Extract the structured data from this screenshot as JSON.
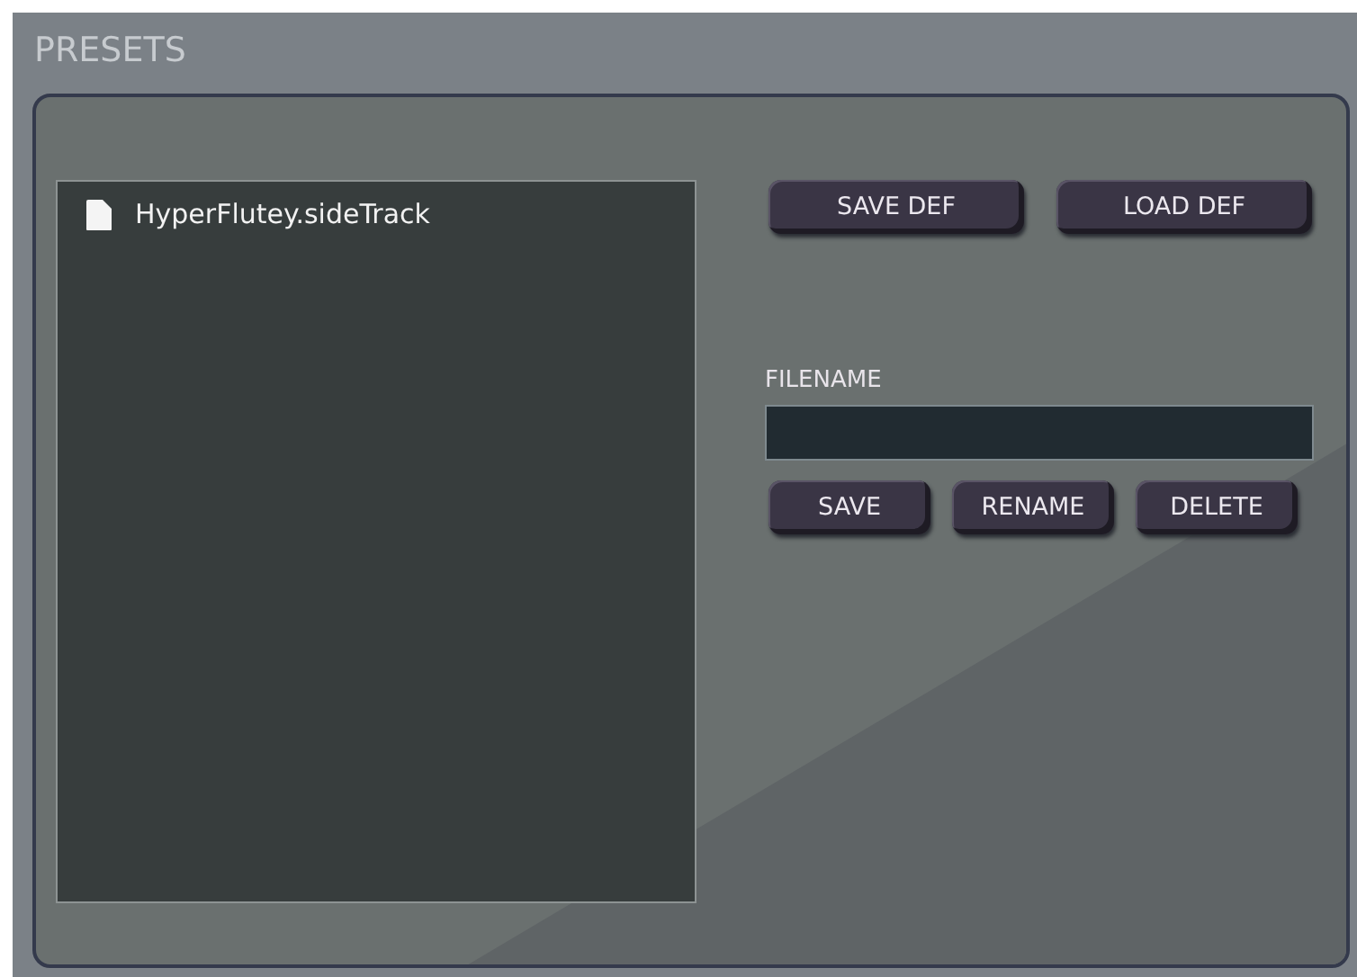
{
  "title": "PRESETS",
  "files": [
    {
      "name": "HyperFlutey.sideTrack"
    }
  ],
  "default_buttons": [
    "SAVE DEF",
    "LOAD DEF"
  ],
  "filename": {
    "label": "FILENAME"
  },
  "file_buttons": [
    "SAVE",
    "RENAME",
    "DELETE"
  ]
}
